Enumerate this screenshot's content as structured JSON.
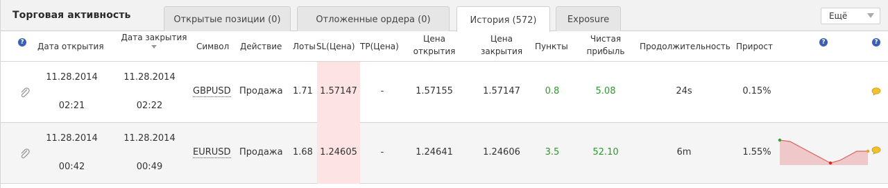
{
  "panel": {
    "title": "Торговая активность",
    "tabs": [
      {
        "label": "Открытые позиции (0)"
      },
      {
        "label": "Отложенные ордера (0)"
      },
      {
        "label": "История (572)"
      },
      {
        "label": "Exposure"
      }
    ],
    "active_tab": "История (572)",
    "more_label": "Ещё"
  },
  "table": {
    "columns": {
      "open_date": "Дата открытия",
      "close_date": "Дата закрытия",
      "symbol": "Символ",
      "action": "Действие",
      "lots": "Лоты",
      "sl": "SL(Цена)",
      "tp": "TP(Цена)",
      "open_price_1": "Цена",
      "open_price_2": "открытия",
      "close_price_1": "Цена",
      "close_price_2": "закрытия",
      "points": "Пункты",
      "profit_1": "Чистая",
      "profit_2": "прибыль",
      "duration": "Продолжительность",
      "growth": "Прирост"
    },
    "help_glyph": "?",
    "rows": [
      {
        "open_date": "11.28.2014",
        "open_time": "02:21",
        "close_date": "11.28.2014",
        "close_time": "02:22",
        "symbol": "GBPUSD",
        "action": "Продажа",
        "lots": "1.71",
        "sl": "1.57147",
        "tp": "-",
        "open_price": "1.57155",
        "close_price": "1.57147",
        "points": "0.8",
        "profit": "5.08",
        "duration": "24s",
        "growth": "0.15%"
      },
      {
        "open_date": "11.28.2014",
        "open_time": "00:42",
        "close_date": "11.28.2014",
        "close_time": "00:49",
        "symbol": "EURUSD",
        "action": "Продажа",
        "lots": "1.68",
        "sl": "1.24605",
        "tp": "-",
        "open_price": "1.24641",
        "close_price": "1.24606",
        "points": "3.5",
        "profit": "52.10",
        "duration": "6m",
        "growth": "1.55%"
      }
    ]
  },
  "colors": {
    "profit_green": "#2a9a2a",
    "sl_highlight": "#fde3e3",
    "sparkline_line": "#e06060",
    "sparkline_fill": "#efc9c9",
    "help_icon": "#3b5fb5",
    "note_icon": "#f2c12e"
  }
}
